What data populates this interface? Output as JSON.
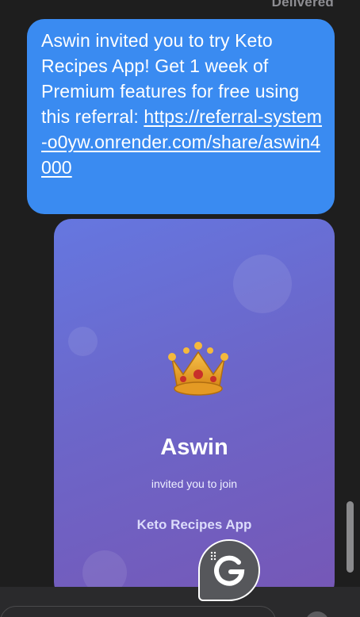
{
  "message": {
    "status": "Delivered",
    "text_prefix": "Aswin invited you to try Keto Recipes App! Get 1 week of Premium features for free using this referral: ",
    "link_text": "https://referral-system-o0yw.onrender.com/share/aswin4000",
    "bubble_color": "#3a8bf1"
  },
  "preview_card": {
    "icon": "crown-icon",
    "name": "Aswin",
    "subtitle": "invited you to join",
    "app_name": "Keto Recipes App",
    "gradient_start": "#6577e0",
    "gradient_end": "#7657b6"
  },
  "widget": {
    "icon": "grammarly-g-icon"
  }
}
